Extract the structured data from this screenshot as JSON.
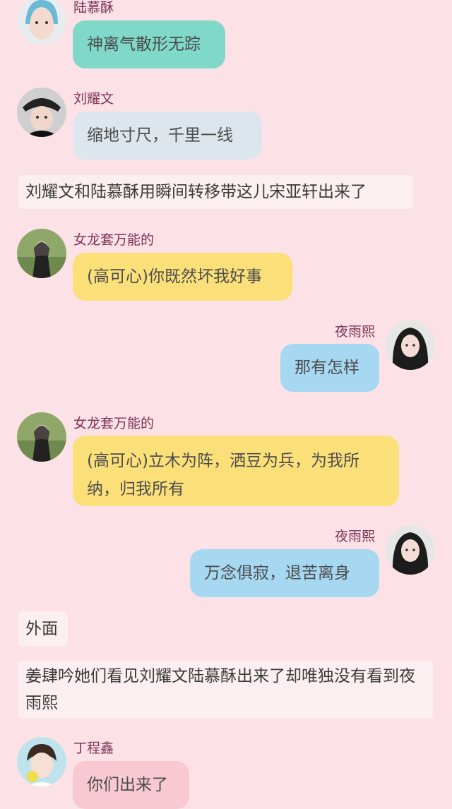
{
  "messages": [
    {
      "type": "left",
      "name": "陆慕酥",
      "text": "神离气散形无踪",
      "color": "#7fd8c8"
    },
    {
      "type": "left",
      "name": "刘耀文",
      "text": "缩地寸尺，千里一线",
      "color": "#dce6ec"
    },
    {
      "type": "narration",
      "text": "刘耀文和陆慕酥用瞬间转移带这儿宋亚轩出来了"
    },
    {
      "type": "left",
      "name": "女龙套万能的",
      "text": "(高可心)你既然坏我好事",
      "color": "#fbe07a"
    },
    {
      "type": "right",
      "name": "夜雨熙",
      "text": "那有怎样",
      "color": "#a6d8f2"
    },
    {
      "type": "left",
      "name": "女龙套万能的",
      "text": "(高可心)立木为阵，洒豆为兵，为我所纳，归我所有",
      "color": "#fbe07a"
    },
    {
      "type": "right",
      "name": "夜雨熙",
      "text": "万念俱寂，退苦离身",
      "color": "#a6d8f2"
    },
    {
      "type": "narration",
      "text": "外面"
    },
    {
      "type": "narration",
      "text": "姜肆吟她们看见刘耀文陆慕酥出来了却唯独没有看到夜雨熙"
    },
    {
      "type": "left",
      "name": "丁程鑫",
      "text": "你们出来了",
      "color": "#f9c9d3"
    }
  ]
}
